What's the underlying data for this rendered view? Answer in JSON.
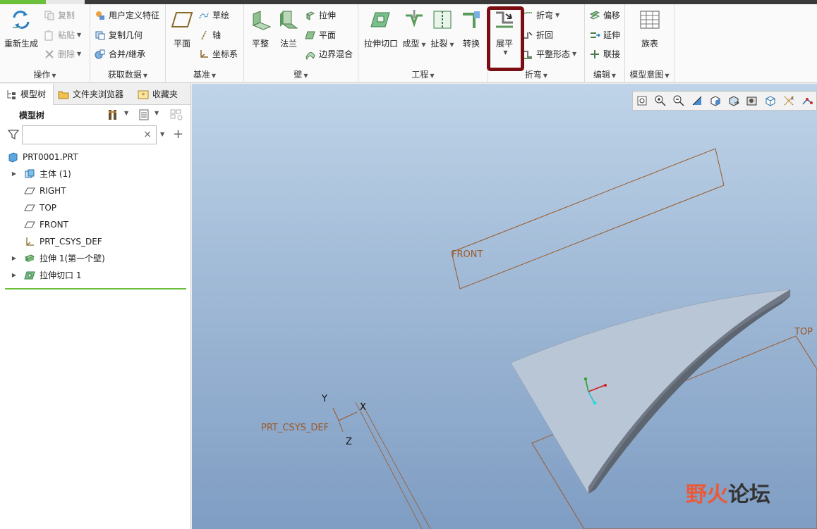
{
  "ribbon": {
    "groups": {
      "operations": {
        "title": "操作",
        "regenerate": "重新生成",
        "copy": "复制",
        "paste": "粘贴",
        "delete": "删除"
      },
      "get_data": {
        "title": "获取数据",
        "user_defined_feature": "用户定义特征",
        "copy_geometry": "复制几何",
        "merge_inherit": "合并/继承"
      },
      "datum": {
        "title": "基准",
        "plane": "平面",
        "sketch": "草绘",
        "axis": "轴",
        "csys": "坐标系"
      },
      "wall": {
        "title": "壁",
        "flat": "平整",
        "flange": "法兰",
        "extrude": "拉伸",
        "plane": "平面",
        "boundary_blend": "边界混合"
      },
      "engineering": {
        "title": "工程",
        "extrude_cut": "拉伸切口",
        "form": "成型",
        "rip": "扯裂",
        "convert": "转换"
      },
      "bend": {
        "title": "折弯",
        "unbend": "展平",
        "bend": "折弯",
        "bend_back": "折回",
        "flat_pattern": "平整形态"
      },
      "edit": {
        "title": "编辑",
        "offset": "偏移",
        "extend": "延伸",
        "join": "联接"
      },
      "model_intent": {
        "title": "模型意图",
        "family_table": "族表"
      }
    }
  },
  "left_panel": {
    "tabs": [
      "模型树",
      "文件夹浏览器",
      "收藏夹"
    ],
    "header": "模型树",
    "search": {
      "value": "",
      "clear": "×"
    },
    "tree": [
      {
        "label": "PRT0001.PRT",
        "expandable": false,
        "indent": 0,
        "icon": "part-icon"
      },
      {
        "label": "主体 (1)",
        "expandable": true,
        "indent": 1,
        "icon": "body-icon"
      },
      {
        "label": "RIGHT",
        "expandable": false,
        "indent": 1,
        "icon": "datum-plane-icon"
      },
      {
        "label": "TOP",
        "expandable": false,
        "indent": 1,
        "icon": "datum-plane-icon"
      },
      {
        "label": "FRONT",
        "expandable": false,
        "indent": 1,
        "icon": "datum-plane-icon"
      },
      {
        "label": "PRT_CSYS_DEF",
        "expandable": false,
        "indent": 1,
        "icon": "csys-icon"
      },
      {
        "label": "拉伸 1(第一个壁)",
        "expandable": true,
        "indent": 1,
        "icon": "extrude-wall-icon"
      },
      {
        "label": "拉伸切口 1",
        "expandable": true,
        "indent": 1,
        "icon": "extrude-cut-icon"
      }
    ]
  },
  "viewport": {
    "labels": {
      "front": "FRONT",
      "top": "TOP",
      "csys": "PRT_CSYS_DEF",
      "x": "X",
      "y": "Y",
      "z": "Z"
    },
    "toolbar_icons": [
      "refit-icon",
      "zoom-in-icon",
      "zoom-out-icon",
      "repaint-icon",
      "orientation-icon",
      "saved-views-icon",
      "display-style-icon",
      "perspective-icon",
      "datum-display-icon",
      "annotation-display-icon"
    ]
  },
  "watermark": {
    "part1": "野火",
    "part2": "论坛"
  },
  "colors": {
    "accent": "#6abf3b",
    "datum": "#9a5a2a",
    "annotation": "#7a0e12"
  }
}
